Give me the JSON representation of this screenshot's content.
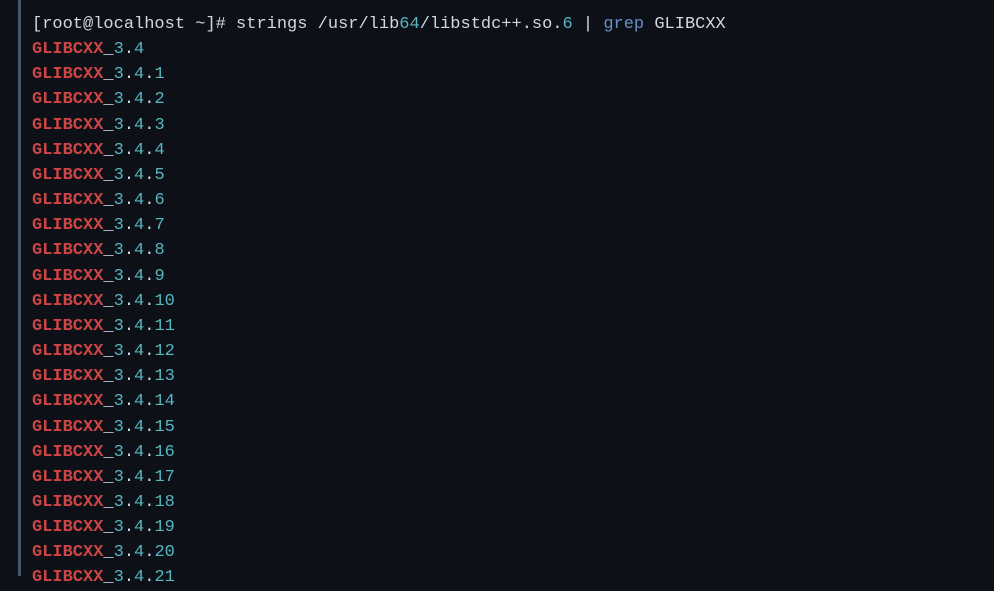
{
  "prompt": {
    "open_bracket": "[",
    "user_host": "root@localhost",
    "path": "~",
    "close_bracket": "]",
    "symbol": "#",
    "cmd_part1": "strings /usr/lib",
    "cmd_num1": "64",
    "cmd_part2": "/libstdc++.so.",
    "cmd_num2": "6",
    "pipe": "|",
    "grep": "grep",
    "grep_arg": "GLIBCXX"
  },
  "output": [
    {
      "match": "GLIBCXX",
      "rest": "_3.4"
    },
    {
      "match": "GLIBCXX",
      "rest": "_3.4.1"
    },
    {
      "match": "GLIBCXX",
      "rest": "_3.4.2"
    },
    {
      "match": "GLIBCXX",
      "rest": "_3.4.3"
    },
    {
      "match": "GLIBCXX",
      "rest": "_3.4.4"
    },
    {
      "match": "GLIBCXX",
      "rest": "_3.4.5"
    },
    {
      "match": "GLIBCXX",
      "rest": "_3.4.6"
    },
    {
      "match": "GLIBCXX",
      "rest": "_3.4.7"
    },
    {
      "match": "GLIBCXX",
      "rest": "_3.4.8"
    },
    {
      "match": "GLIBCXX",
      "rest": "_3.4.9"
    },
    {
      "match": "GLIBCXX",
      "rest": "_3.4.10"
    },
    {
      "match": "GLIBCXX",
      "rest": "_3.4.11"
    },
    {
      "match": "GLIBCXX",
      "rest": "_3.4.12"
    },
    {
      "match": "GLIBCXX",
      "rest": "_3.4.13"
    },
    {
      "match": "GLIBCXX",
      "rest": "_3.4.14"
    },
    {
      "match": "GLIBCXX",
      "rest": "_3.4.15"
    },
    {
      "match": "GLIBCXX",
      "rest": "_3.4.16"
    },
    {
      "match": "GLIBCXX",
      "rest": "_3.4.17"
    },
    {
      "match": "GLIBCXX",
      "rest": "_3.4.18"
    },
    {
      "match": "GLIBCXX",
      "rest": "_3.4.19"
    },
    {
      "match": "GLIBCXX",
      "rest": "_3.4.20"
    },
    {
      "match": "GLIBCXX",
      "rest": "_3.4.21"
    }
  ]
}
